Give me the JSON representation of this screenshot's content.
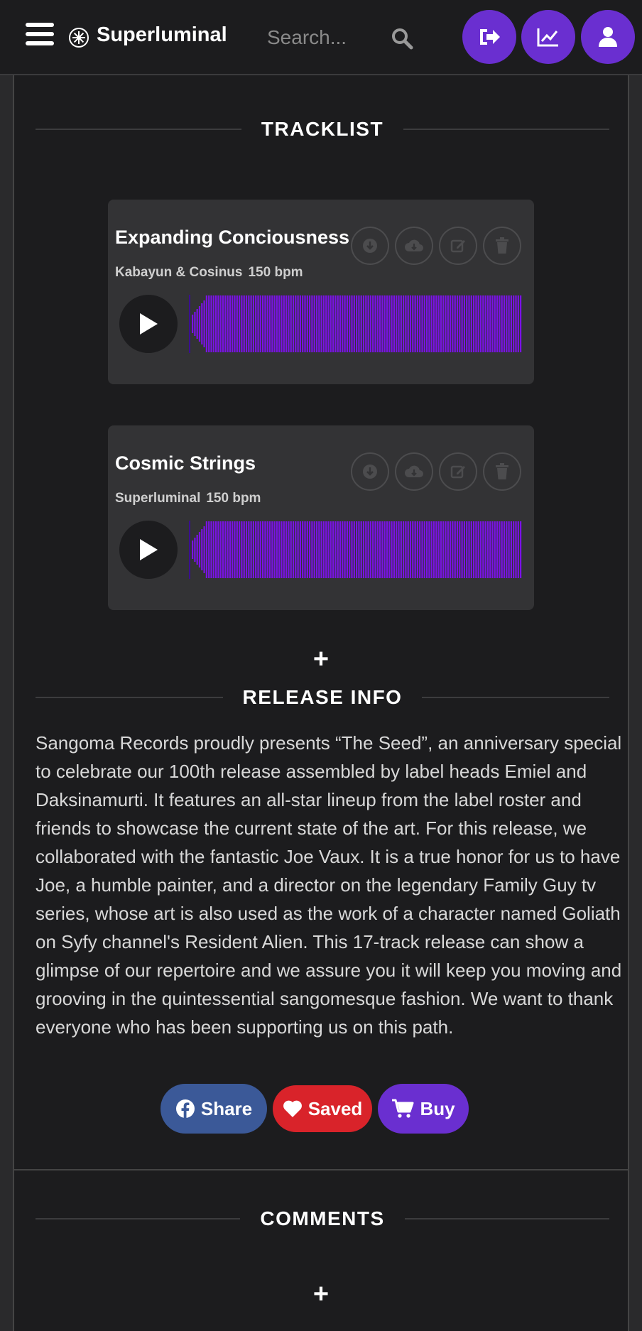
{
  "header": {
    "brand": "Superluminal",
    "search_placeholder": "Search..."
  },
  "tracklist": {
    "title": "TRACKLIST",
    "tracks": [
      {
        "title": "Expanding Conciousness",
        "artist": "Kabayun & Cosinus",
        "bpm": "150 bpm"
      },
      {
        "title": "Cosmic Strings",
        "artist": "Superluminal",
        "bpm": "150 bpm"
      }
    ]
  },
  "release_info": {
    "title": "RELEASE INFO",
    "text": "Sangoma Records proudly presents “The Seed”, an anniversary special to celebrate our 100th release assembled by label heads Emiel and Daksinamurti. It features an all-star lineup from the label roster and friends to showcase the current state of the art. For this release, we collaborated with the fantastic Joe Vaux. It is a true honor for us to have Joe, a humble painter, and a director on the legendary Family Guy tv series, whose art is also used as the work of a character named Goliath on Syfy channel's Resident Alien. This 17-track release can show a glimpse of our repertoire and we assure you it will keep you moving and grooving in the quintessential sangomesque fashion. We want to thank everyone who has been supporting us on this path.",
    "share_label": "Share",
    "saved_label": "Saved",
    "buy_label": "Buy"
  },
  "comments": {
    "title": "COMMENTS"
  },
  "colors": {
    "accent": "#6a2fd0",
    "waveform": "#7a12e6",
    "share": "#3b5998",
    "saved": "#d9232a",
    "buy": "#6a2fd0"
  }
}
